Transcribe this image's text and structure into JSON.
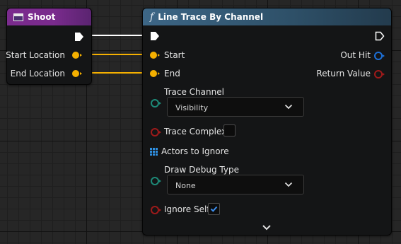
{
  "shoot_node": {
    "title": "Shoot",
    "outputs": [
      "Start Location",
      "End Location"
    ]
  },
  "trace_node": {
    "title": "Line Trace By Channel",
    "inputs": {
      "start": "Start",
      "end": "End",
      "trace_channel_label": "Trace Channel",
      "trace_channel_value": "Visibility",
      "trace_complex_label": "Trace Complex",
      "trace_complex_checked": false,
      "actors_to_ignore_label": "Actors to Ignore",
      "draw_debug_type_label": "Draw Debug Type",
      "draw_debug_type_value": "None",
      "ignore_self_label": "Ignore Self",
      "ignore_self_checked": true
    },
    "outputs": {
      "out_hit": "Out Hit",
      "return_value": "Return Value"
    }
  },
  "colors": {
    "exec_wire": "#ffffff",
    "vector_wire": "#f5b000",
    "hit_result_pin": "#1d6fd6",
    "bool_pin": "#9e1a1a",
    "enum_pin": "#1d8a78",
    "object_array_pin": "#2f8fe0",
    "shoot_header": "#7a2b8d",
    "function_header": "#3d6686"
  },
  "icons": {
    "event": "event-node-icon",
    "function": "function-f-icon",
    "advanced_display": "chevron-down-icon"
  }
}
